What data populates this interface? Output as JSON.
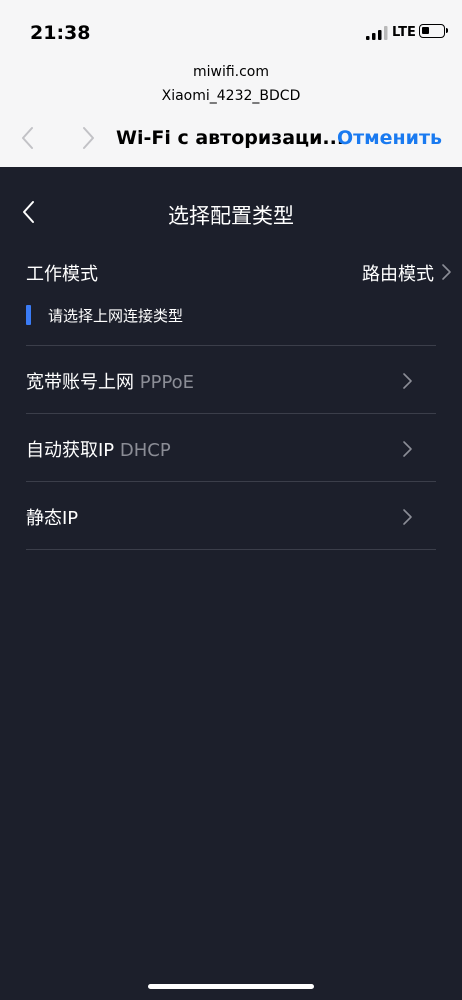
{
  "status_bar": {
    "time": "21:38",
    "network": "LTE"
  },
  "browser": {
    "url_line1": "miwifi.com",
    "url_line2": "Xiaomi_4232_BDCD",
    "title": "Wi-Fi с авторизаци...",
    "cancel_label": "Отменить"
  },
  "app": {
    "title": "选择配置类型",
    "mode_label": "工作模式",
    "mode_value": "路由模式",
    "hint": "请选择上网连接类型",
    "options": [
      {
        "label": "宽带账号上网",
        "sub": "PPPoE"
      },
      {
        "label": "自动获取IP",
        "sub": "DHCP"
      },
      {
        "label": "静态IP",
        "sub": ""
      }
    ]
  },
  "colors": {
    "accent": "#1a7af0",
    "hint_bar": "#3a7bf5",
    "background": "#1c1f2b"
  }
}
